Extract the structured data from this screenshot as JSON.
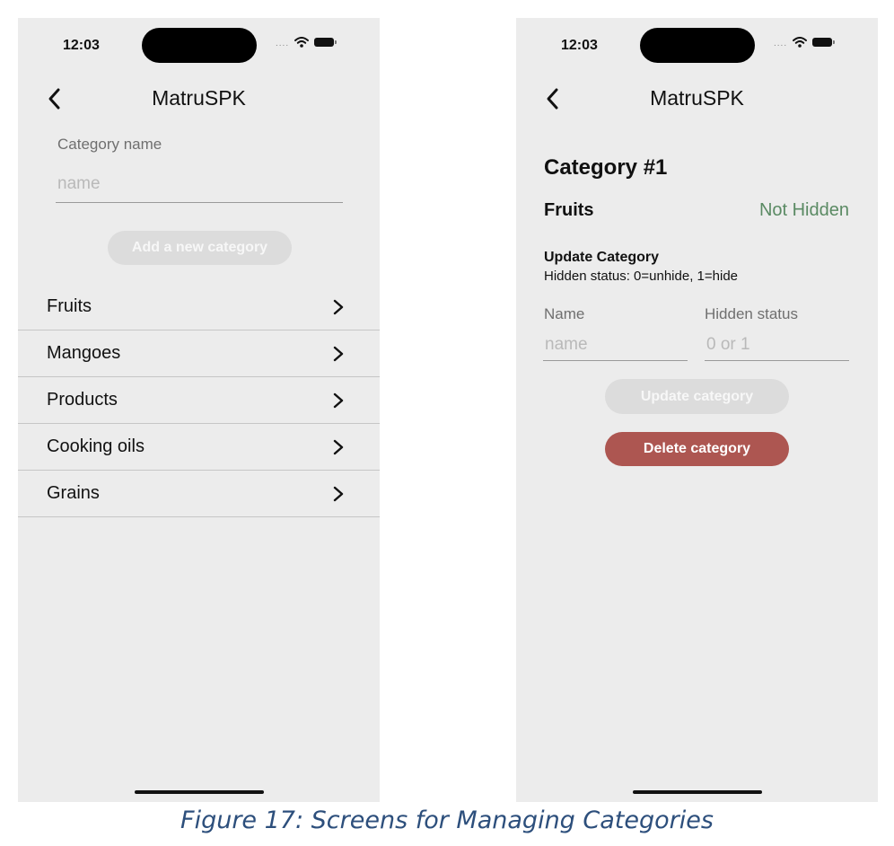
{
  "colors": {
    "phone_bg": "#ececec",
    "danger": "#ad5651",
    "success_text": "#5a8a63",
    "disabled_button": "#dcdcdc",
    "caption": "#2d4f7c"
  },
  "left_screen": {
    "status_bar": {
      "time": "12:03",
      "icons": [
        "signal-dots-icon",
        "wifi-icon",
        "battery-icon"
      ]
    },
    "nav": {
      "back_icon": "chevron-left-icon",
      "title": "MatruSPK"
    },
    "form": {
      "label": "Category name",
      "placeholder": "name",
      "value": "",
      "add_button_label": "Add a new category"
    },
    "categories": [
      {
        "label": "Fruits"
      },
      {
        "label": "Mangoes"
      },
      {
        "label": "Products"
      },
      {
        "label": "Cooking oils"
      },
      {
        "label": "Grains"
      }
    ]
  },
  "right_screen": {
    "status_bar": {
      "time": "12:03",
      "icons": [
        "signal-dots-icon",
        "wifi-icon",
        "battery-icon"
      ]
    },
    "nav": {
      "back_icon": "chevron-left-icon",
      "title": "MatruSPK"
    },
    "heading": "Category #1",
    "category_name": "Fruits",
    "status": "Not Hidden",
    "update_section": {
      "title": "Update Category",
      "hint": "Hidden status: 0=unhide, 1=hide",
      "name_label": "Name",
      "name_placeholder": "name",
      "hidden_label": "Hidden status",
      "hidden_placeholder": "0 or 1",
      "update_button_label": "Update category",
      "delete_button_label": "Delete category"
    }
  },
  "caption": "Figure 17: Screens for Managing Categories"
}
